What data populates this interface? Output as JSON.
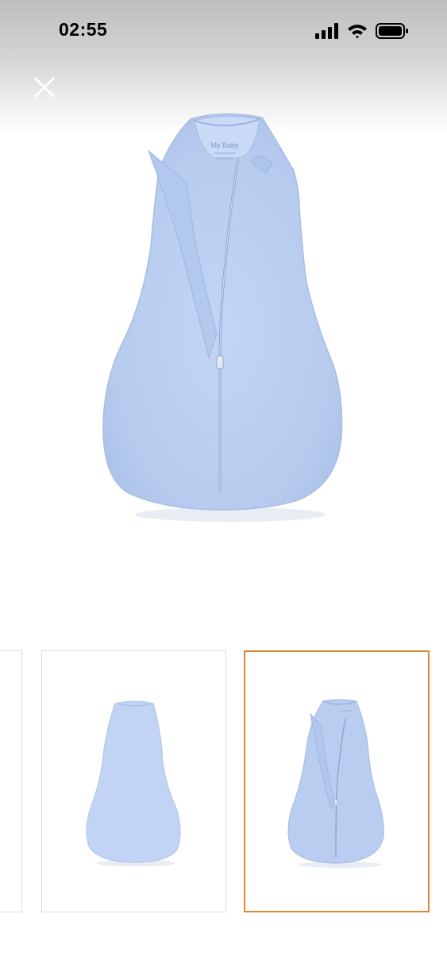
{
  "status_bar": {
    "time": "02:55",
    "icons": [
      "cellular-signal-icon",
      "wifi-icon",
      "battery-icon"
    ]
  },
  "header": {
    "close_icon": "close-icon"
  },
  "main_image": {
    "label_brand": "My Baby",
    "garment_color": "#b9cdf0"
  },
  "thumbnails": {
    "selected_index": 2,
    "accent_color": "#e2872f",
    "items": [
      {
        "name": "thumbnail-partial"
      },
      {
        "name": "thumbnail-back-view"
      },
      {
        "name": "thumbnail-front-zip-view"
      }
    ]
  }
}
